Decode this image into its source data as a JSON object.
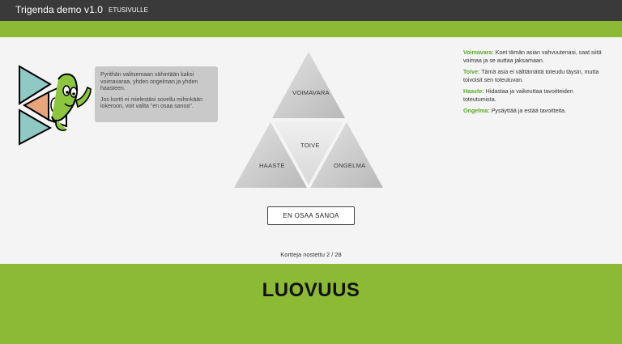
{
  "header": {
    "title": "Trigenda demo v1.0",
    "nav_home": "ETUSIVULLE"
  },
  "speech": {
    "paragraph1": "Pyrithän valitsemaan vähintään kaksi voimavaraa, yhden ongelman ja yhden haasteen.",
    "paragraph2": "Jos kortti ei mielestäsi sovellu mihinkään lokeroon, voit valita \"en osaa sanoa\"."
  },
  "triangle": {
    "top": "VOIMAVARA",
    "center": "TOIVE",
    "left": "HAASTE",
    "right": "ONGELMA"
  },
  "legend": [
    {
      "term": "Voimavara:",
      "text": "Koet tämän asian vahvuutenasi, saat siitä voimaa ja se auttaa jaksamaan."
    },
    {
      "term": "Toive:",
      "text": "Tämä asia ei välttämättä toteudu täysin, mutta toivoisit sen toteutuvan."
    },
    {
      "term": "Haaste:",
      "text": "Hidastaa ja vaikeuttaa tavoitteiden toteutumista."
    },
    {
      "term": "Ongelma:",
      "text": "Pysäyttää ja estää tavoitteita."
    }
  ],
  "button": {
    "label": "EN OSAA SANOA"
  },
  "counter": "Kortteja nostettu 2 / 28",
  "card": {
    "word": "LUOVUUS"
  },
  "colors": {
    "accent": "#8cba34",
    "header": "#3a3a3a",
    "legend_term": "#5aa82d"
  }
}
